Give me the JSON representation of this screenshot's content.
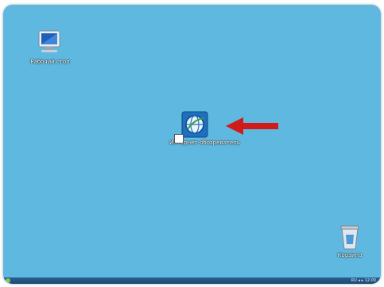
{
  "desktop": {
    "background_color": "#5fb8df",
    "icons": [
      {
        "name": "computer-icon",
        "label": "Рабочий стол"
      },
      {
        "name": "internet-browser-icon",
        "label": "Интернет-обозреватель"
      },
      {
        "name": "recycle-bin-icon",
        "label": "Корзина"
      }
    ]
  },
  "annotation": {
    "name": "red-arrow-pointer",
    "color": "#d11a1a"
  },
  "taskbar": {
    "color": "#1d4a73",
    "start_icon": "windows-start-icon",
    "tray_text": "RU  ◂ ▸  12:00"
  }
}
